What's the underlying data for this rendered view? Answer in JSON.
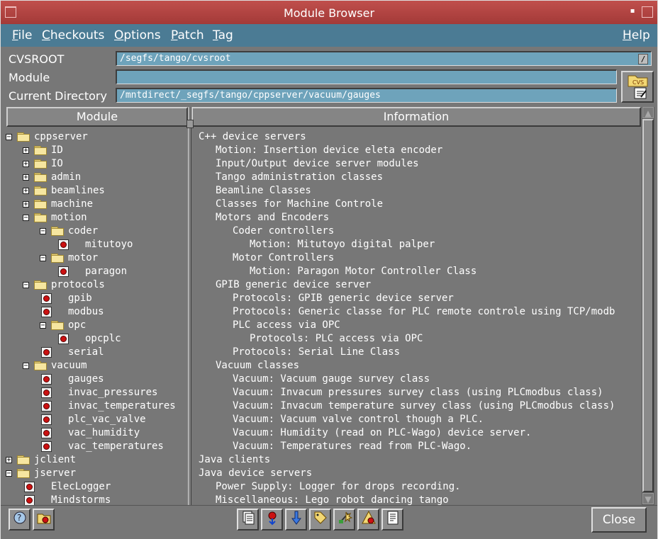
{
  "window": {
    "title": "Module Browser"
  },
  "menu": {
    "file": {
      "u": "F",
      "rest": "ile"
    },
    "checkouts": {
      "u": "C",
      "rest": "heckouts"
    },
    "options": {
      "u": "O",
      "rest": "ptions"
    },
    "patch": {
      "u": "P",
      "rest": "atch"
    },
    "tag": {
      "u": "T",
      "rest": "ag"
    },
    "help": {
      "u": "H",
      "rest": "elp"
    }
  },
  "fields": {
    "cvsroot_label": "CVSROOT",
    "cvsroot_value": "/segfs/tango/cvsroot",
    "module_label": "Module",
    "module_value": "",
    "curdir_label": "Current Directory",
    "curdir_value": "/mntdirect/_segfs/tango/cppserver/vacuum/gauges"
  },
  "columns": {
    "module": "Module",
    "information": "Information"
  },
  "tree": [
    {
      "label": "cppserver",
      "kind": "folder",
      "exp": "−",
      "info": "C++ device servers"
    },
    {
      "label": "ID",
      "kind": "folder",
      "exp": "+",
      "info": "Motion: Insertion device eleta encoder"
    },
    {
      "label": "IO",
      "kind": "folder",
      "exp": "+",
      "info": "Input/Output device server modules"
    },
    {
      "label": "admin",
      "kind": "folder",
      "exp": "+",
      "info": "Tango administration classes"
    },
    {
      "label": "beamlines",
      "kind": "folder",
      "exp": "+",
      "info": "Beamline Classes"
    },
    {
      "label": "machine",
      "kind": "folder",
      "exp": "+",
      "info": "Classes for Machine Controle"
    },
    {
      "label": "motion",
      "kind": "folder",
      "exp": "−",
      "info": "Motors and Encoders"
    },
    {
      "label": "coder",
      "kind": "folder",
      "exp": "−",
      "info": "Coder controllers"
    },
    {
      "label": "mitutoyo",
      "kind": "leaf",
      "info": "Motion: Mitutoyo digital palper"
    },
    {
      "label": "motor",
      "kind": "folder",
      "exp": "−",
      "info": "Motor Controllers"
    },
    {
      "label": "paragon",
      "kind": "leaf",
      "info": "Motion: Paragon Motor Controller Class"
    },
    {
      "label": "protocols",
      "kind": "folder",
      "exp": "−",
      "info": "GPIB generic device server"
    },
    {
      "label": "gpib",
      "kind": "leaf",
      "info": "Protocols: GPIB generic device server"
    },
    {
      "label": "modbus",
      "kind": "leaf",
      "info": "Protocols: Generic classe for PLC remote controle using TCP/modb"
    },
    {
      "label": "opc",
      "kind": "folder",
      "exp": "−",
      "info": "PLC access via OPC"
    },
    {
      "label": "opcplc",
      "kind": "leaf",
      "info": "Protocols: PLC access via OPC"
    },
    {
      "label": "serial",
      "kind": "leaf",
      "info": "Protocols: Serial Line Class"
    },
    {
      "label": "vacuum",
      "kind": "folder",
      "exp": "−",
      "info": "Vacuum classes"
    },
    {
      "label": "gauges",
      "kind": "leaf",
      "info": "Vacuum: Vacuum gauge survey class"
    },
    {
      "label": "invac_pressures",
      "kind": "leaf",
      "info": "Vacuum: Invacum pressures survey class (using PLCmodbus class)"
    },
    {
      "label": "invac_temperatures",
      "kind": "leaf",
      "info": "Vacuum: Invacum temperature survey class (using PLCmodbus class)"
    },
    {
      "label": "plc_vac_valve",
      "kind": "leaf",
      "info": "Vacuum: Vacuum valve control though a PLC."
    },
    {
      "label": "vac_humidity",
      "kind": "leaf",
      "info": "Vacuum: Humidity (read on PLC-Wago) device server."
    },
    {
      "label": "vac_temperatures",
      "kind": "leaf",
      "info": "Vacuum: Temperatures read from PLC-Wago."
    },
    {
      "label": "jclient",
      "kind": "folder",
      "exp": "+",
      "info": "Java clients"
    },
    {
      "label": "jserver",
      "kind": "folder",
      "exp": "−",
      "info": "Java device servers"
    },
    {
      "label": "ElecLogger",
      "kind": "leaf",
      "info": "Power Supply: Logger for drops recording."
    },
    {
      "label": "Mindstorms",
      "kind": "leaf",
      "info": "Miscellaneous: Lego robot dancing tango"
    }
  ],
  "buttons": {
    "close": "Close"
  },
  "icons": {
    "cvs_button": "cvs-folder-icon",
    "toolbar": [
      "help-icon",
      "open-folder-icon",
      "document-icon",
      "checkout-icon",
      "download-icon",
      "tag-icon",
      "merge-icon",
      "warning-icon",
      "log-icon"
    ]
  },
  "colors": {
    "titlebar": "#b0423f",
    "menubar": "#4b7b94",
    "field": "#6ea3bb",
    "background": "#777777"
  }
}
